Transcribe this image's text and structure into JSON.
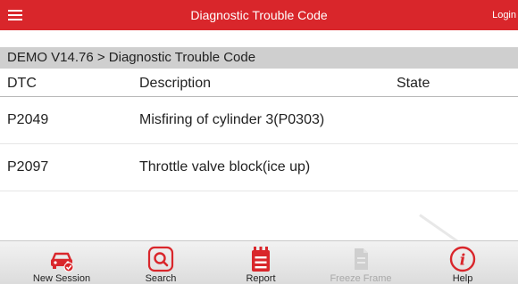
{
  "header": {
    "title": "Diagnostic Trouble Code",
    "login_label": "Login"
  },
  "breadcrumb": "DEMO V14.76 > Diagnostic Trouble Code",
  "table": {
    "columns": [
      "DTC",
      "Description",
      "State"
    ],
    "rows": [
      {
        "dtc": "P2049",
        "description": "Misfiring of cylinder 3(P0303)",
        "state": ""
      },
      {
        "dtc": "P2097",
        "description": "Throttle valve block(ice up)",
        "state": ""
      }
    ]
  },
  "toolbar": {
    "items": [
      {
        "label": "New Session",
        "icon": "car-check-icon",
        "enabled": true
      },
      {
        "label": "Search",
        "icon": "search-icon",
        "enabled": true
      },
      {
        "label": "Report",
        "icon": "report-icon",
        "enabled": true
      },
      {
        "label": "Freeze Frame",
        "icon": "freeze-frame-icon",
        "enabled": false
      },
      {
        "label": "Help",
        "icon": "help-icon",
        "enabled": true
      }
    ]
  },
  "colors": {
    "accent": "#d9262b",
    "breadcrumb_bg": "#cfcfcf",
    "toolbar_bg": "#e6e6e6"
  }
}
